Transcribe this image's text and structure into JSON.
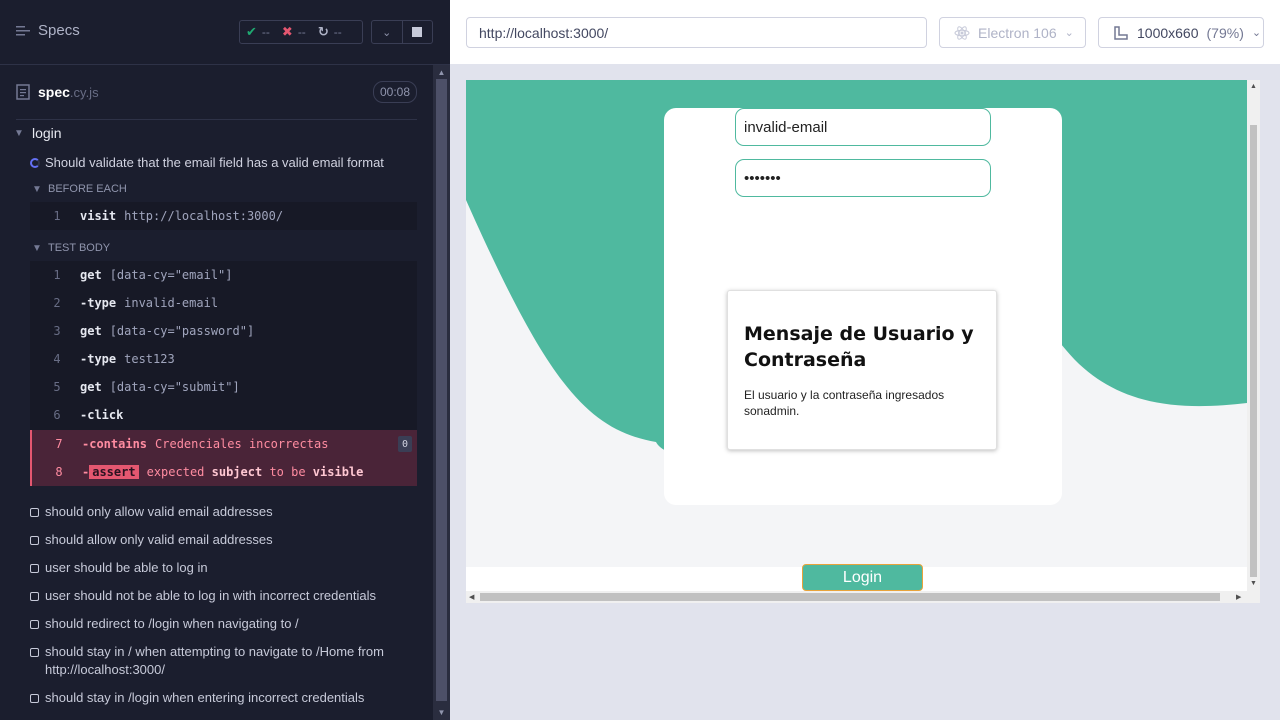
{
  "reporter": {
    "specs_label": "Specs",
    "stats": {
      "passed": "--",
      "failed": "--",
      "pending": "--"
    },
    "spec_file": {
      "name": "spec",
      "ext": ".cy.js",
      "duration": "00:08"
    },
    "suite": "login",
    "running_test": "Should validate that the email field has a valid email format",
    "before_each": {
      "label": "BEFORE EACH",
      "commands": [
        {
          "num": "1",
          "name": "visit",
          "message": "http://localhost:3000/"
        }
      ]
    },
    "test_body": {
      "label": "TEST BODY",
      "commands": [
        {
          "num": "1",
          "name": "get",
          "message": "[data-cy=\"email\"]"
        },
        {
          "num": "2",
          "name": "-type",
          "message": "invalid-email"
        },
        {
          "num": "3",
          "name": "get",
          "message": "[data-cy=\"password\"]"
        },
        {
          "num": "4",
          "name": "-type",
          "message": "test123"
        },
        {
          "num": "5",
          "name": "get",
          "message": "[data-cy=\"submit\"]"
        },
        {
          "num": "6",
          "name": "-click",
          "message": ""
        }
      ],
      "failed_contains": {
        "num": "7",
        "name": "-contains",
        "message": "Credenciales incorrectas",
        "count": "0"
      },
      "failed_assert": {
        "num": "8",
        "prefix": "-",
        "name": "assert",
        "w1": "expected",
        "w2": "subject",
        "w3": "to be",
        "w4": "visible"
      }
    },
    "other_tests": [
      "should only allow valid email addresses",
      "should allow only valid email addresses",
      "user should be able to log in",
      "user should not be able to log in with incorrect credentials",
      "should redirect to /login when navigating to /",
      "should stay in / when attempting to navigate to /Home from http://localhost:3000/",
      "should stay in /login when entering incorrect credentials"
    ]
  },
  "aut": {
    "url": "http://localhost:3000/",
    "browser": "Electron 106",
    "viewport": "1000x660",
    "zoom": "(79%)",
    "app": {
      "email_value": "invalid-email",
      "password_value": "•••••••",
      "modal_title": "Mensaje de Usuario y Contraseña",
      "modal_body": "El usuario y la contraseña ingresados sonadmin.",
      "login_button": "Login"
    }
  },
  "colors": {
    "accent": "#4fb99f",
    "fail": "#e45770",
    "reporter_bg": "#1b1e2e"
  }
}
